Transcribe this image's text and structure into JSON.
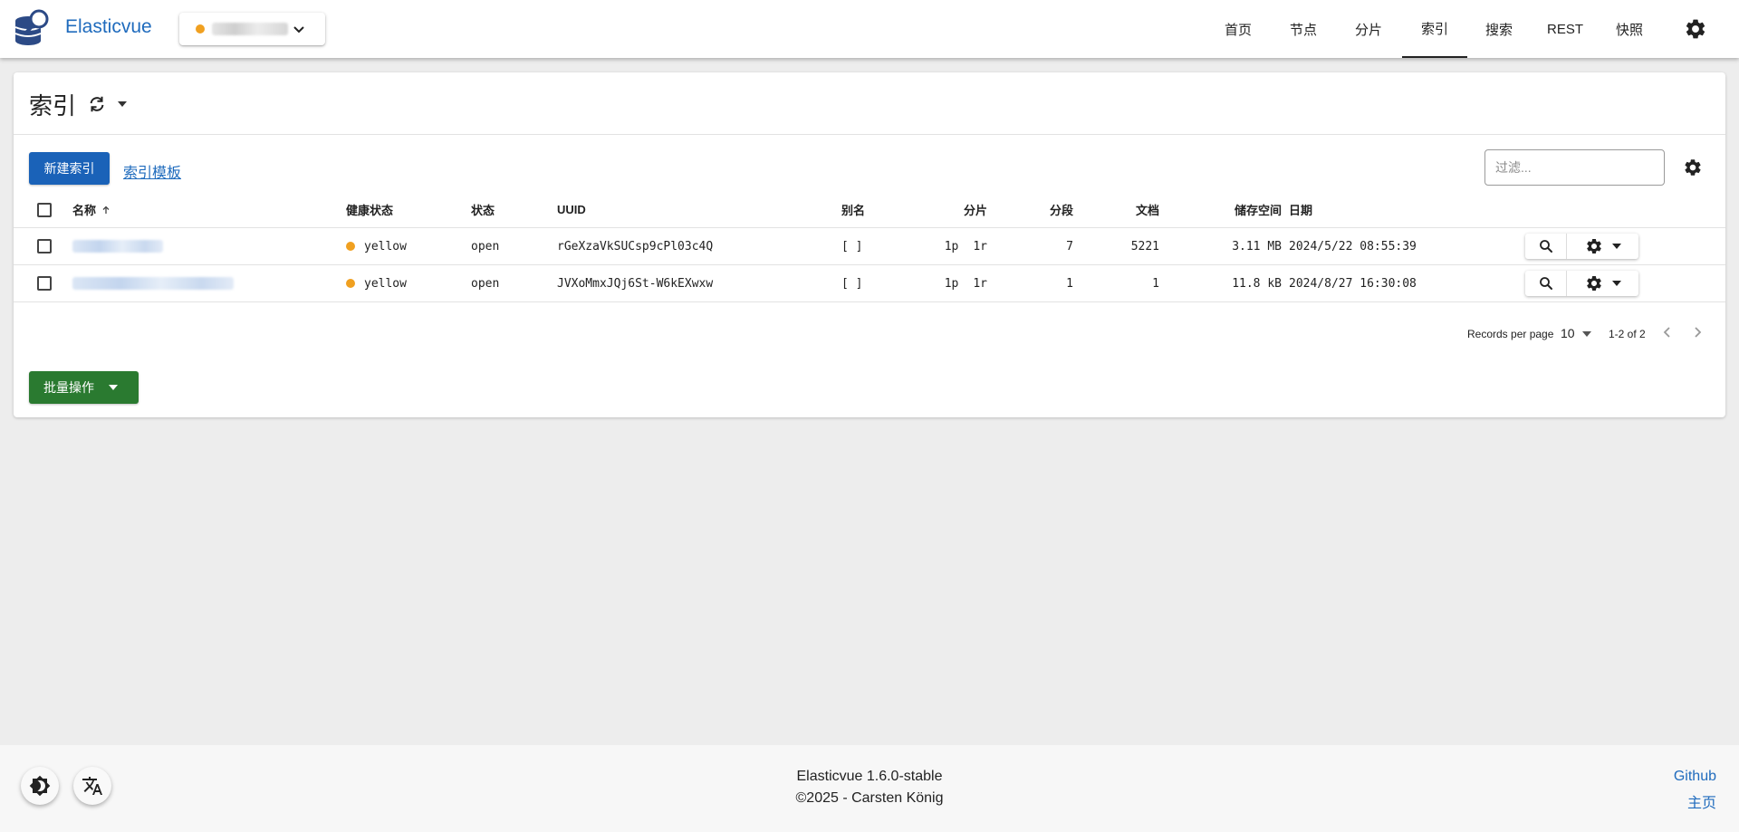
{
  "app": {
    "title": "Elasticvue",
    "cluster": {
      "name": "cluster",
      "health_color": "#f0a020"
    }
  },
  "nav": {
    "items": [
      {
        "label": "首页"
      },
      {
        "label": "节点"
      },
      {
        "label": "分片"
      },
      {
        "label": "索引",
        "active": true
      },
      {
        "label": "搜索"
      },
      {
        "label": "REST"
      },
      {
        "label": "快照"
      }
    ]
  },
  "page": {
    "title": "索引",
    "new_index_label": "新建索引",
    "templates_label": "索引模板",
    "filter_placeholder": "过滤..."
  },
  "table": {
    "columns": [
      "名称",
      "健康状态",
      "状态",
      "UUID",
      "别名",
      "分片",
      "分段",
      "文档",
      "储存空间",
      "日期"
    ],
    "rows": [
      {
        "name": "index-1",
        "health": "yellow",
        "status": "open",
        "uuid": "rGeXzaVkSUCsp9cPl03c4Q",
        "aliases": "[ ]",
        "primaries": "1p",
        "replicas": "1r",
        "segments": "7",
        "docs": "5221",
        "storage": "3.11 MB",
        "date": "2024/5/22 08:55:39"
      },
      {
        "name": "index-2",
        "health": "yellow",
        "status": "open",
        "uuid": "JVXoMmxJQj6St-W6kEXwxw",
        "aliases": "[ ]",
        "primaries": "1p",
        "replicas": "1r",
        "segments": "1",
        "docs": "1",
        "storage": "11.8 kB",
        "date": "2024/8/27 16:30:08"
      }
    ]
  },
  "pagination": {
    "records_per_page_label": "Records per page",
    "records_per_page": "10",
    "range": "1-2 of 2"
  },
  "bulk": {
    "label": "批量操作"
  },
  "footer": {
    "version": "Elasticvue 1.6.0-stable",
    "copyright": "©2025 - Carsten König",
    "github_label": "Github",
    "home_label": "主页"
  },
  "colors": {
    "primary": "#1a62b8",
    "link": "#1f6bbd",
    "success": "#2a7a30",
    "health_yellow": "#f0a020"
  },
  "icons": [
    "elasticvue-logo-icon",
    "chevron-down-icon",
    "gear-icon",
    "refresh-icon",
    "caret-down-icon",
    "sort-ascending-icon",
    "search-icon",
    "chevron-left-icon",
    "chevron-right-icon",
    "theme-toggle-icon",
    "translate-icon"
  ]
}
